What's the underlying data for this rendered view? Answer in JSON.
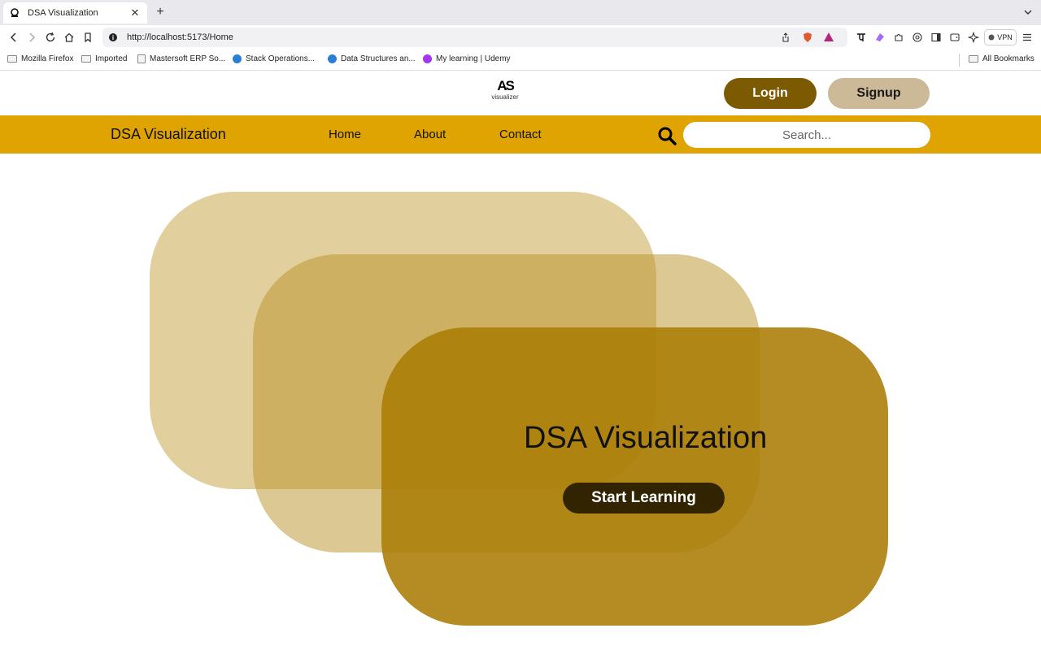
{
  "browser": {
    "tab_title": "DSA Visualization",
    "close_glyph": "✕",
    "newtab_glyph": "+",
    "url": "http://localhost:5173/Home",
    "vpn_label": "VPN",
    "bookmarks": [
      {
        "label": "Mozilla Firefox",
        "icon": "folder-icon"
      },
      {
        "label": "Imported",
        "icon": "folder-icon"
      },
      {
        "label": "Mastersoft ERP So...",
        "icon": "document-icon"
      },
      {
        "label": "Stack Operations...",
        "icon": "site-icon"
      },
      {
        "label": "Data Structures an...",
        "icon": "site-icon"
      },
      {
        "label": "My learning | Udemy",
        "icon": "udemy-icon"
      }
    ],
    "all_bookmarks": "All Bookmarks"
  },
  "header": {
    "logo_mark": "AS",
    "logo_sub": "visualizer",
    "login_label": "Login",
    "signup_label": "Signup"
  },
  "navbar": {
    "brand": "DSA Visualization",
    "links": [
      "Home",
      "About",
      "Contact"
    ],
    "search_placeholder": "Search..."
  },
  "hero": {
    "title": "DSA Visualization",
    "cta_label": "Start Learning"
  },
  "colors": {
    "navbar": "#e0a402",
    "login": "#7b5a02",
    "signup": "#cbb997",
    "cta": "#332401"
  }
}
